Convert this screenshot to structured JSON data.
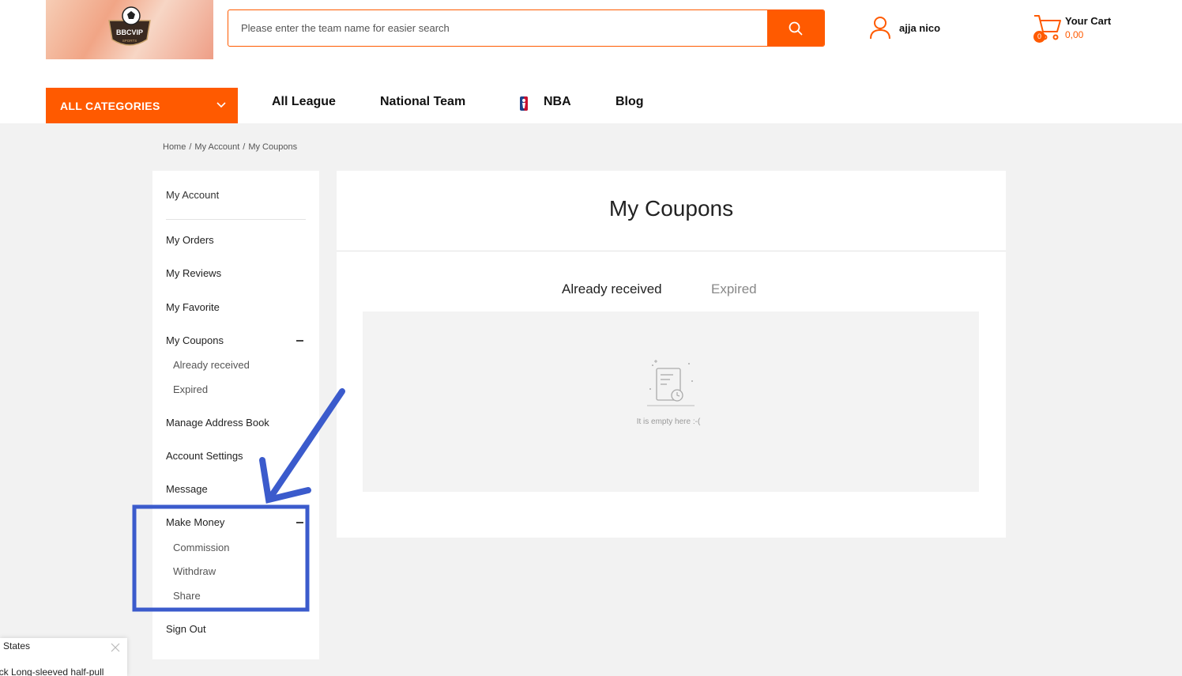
{
  "header": {
    "logo_text": "BBCVIP",
    "logo_subtext": "SPORTS",
    "search": {
      "placeholder": "Please enter the team name for easier search"
    },
    "user_name": "ajja nico",
    "cart": {
      "title": "Your Cart",
      "amount": "0,00",
      "count": "0"
    }
  },
  "nav": {
    "categories_label": "ALL CATEGORIES",
    "items": [
      "All League",
      "National Team",
      "NBA",
      "Blog"
    ]
  },
  "breadcrumb": [
    "Home",
    "My Account",
    "My Coupons"
  ],
  "breadcrumb_sep": "/",
  "sidebar": {
    "my_account": "My Account",
    "my_orders": "My Orders",
    "my_reviews": "My Reviews",
    "my_favorite": "My Favorite",
    "my_coupons": "My Coupons",
    "coupons_sub": [
      "Already received",
      "Expired"
    ],
    "manage_address": "Manage Address Book",
    "account_settings": "Account Settings",
    "message": "Message",
    "make_money": "Make Money",
    "money_sub": [
      "Commission",
      "Withdraw",
      "Share"
    ],
    "sign_out": "Sign Out"
  },
  "main": {
    "title": "My Coupons",
    "tabs": [
      "Already received",
      "Expired"
    ],
    "empty_text": "It is empty here :-("
  },
  "toast": {
    "line1": "d States",
    "line2": "ack Long-sleeved half-pull"
  },
  "colors": {
    "accent": "#ff5a00",
    "annotation": "#3b5bcc",
    "background": "#f2f2f2"
  }
}
